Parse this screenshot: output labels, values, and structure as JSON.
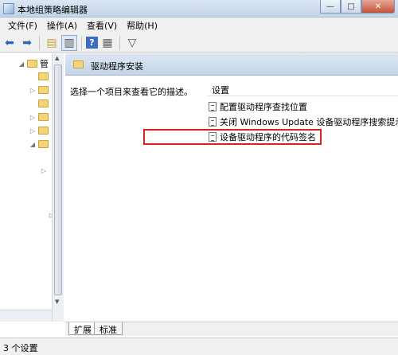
{
  "window": {
    "title": "本地组策略编辑器",
    "buttons": {
      "minimize": "—",
      "maximize": "□",
      "close": "✕"
    }
  },
  "menu": [
    "文件(F)",
    "操作(A)",
    "查看(V)",
    "帮助(H)"
  ],
  "toolbar": {
    "icons": [
      "back-arrow-icon",
      "forward-arrow-icon",
      "up-folder-icon",
      "show-hide-tree-icon",
      "help-icon",
      "properties-icon",
      "filter-icon"
    ]
  },
  "tree": {
    "top_item_label": "管"
  },
  "right_pane": {
    "header_title": "驱动程序安装",
    "description": "选择一个项目来查看它的描述。",
    "column_header": "设置",
    "rows": [
      "配置驱动程序查找位置",
      "关闭 Windows Update 设备驱动程序搜索提示",
      "设备驱动程序的代码签名"
    ],
    "highlight_color": "#d9231f"
  },
  "tabs": [
    "扩展",
    "标准"
  ],
  "status": "3 个设置"
}
